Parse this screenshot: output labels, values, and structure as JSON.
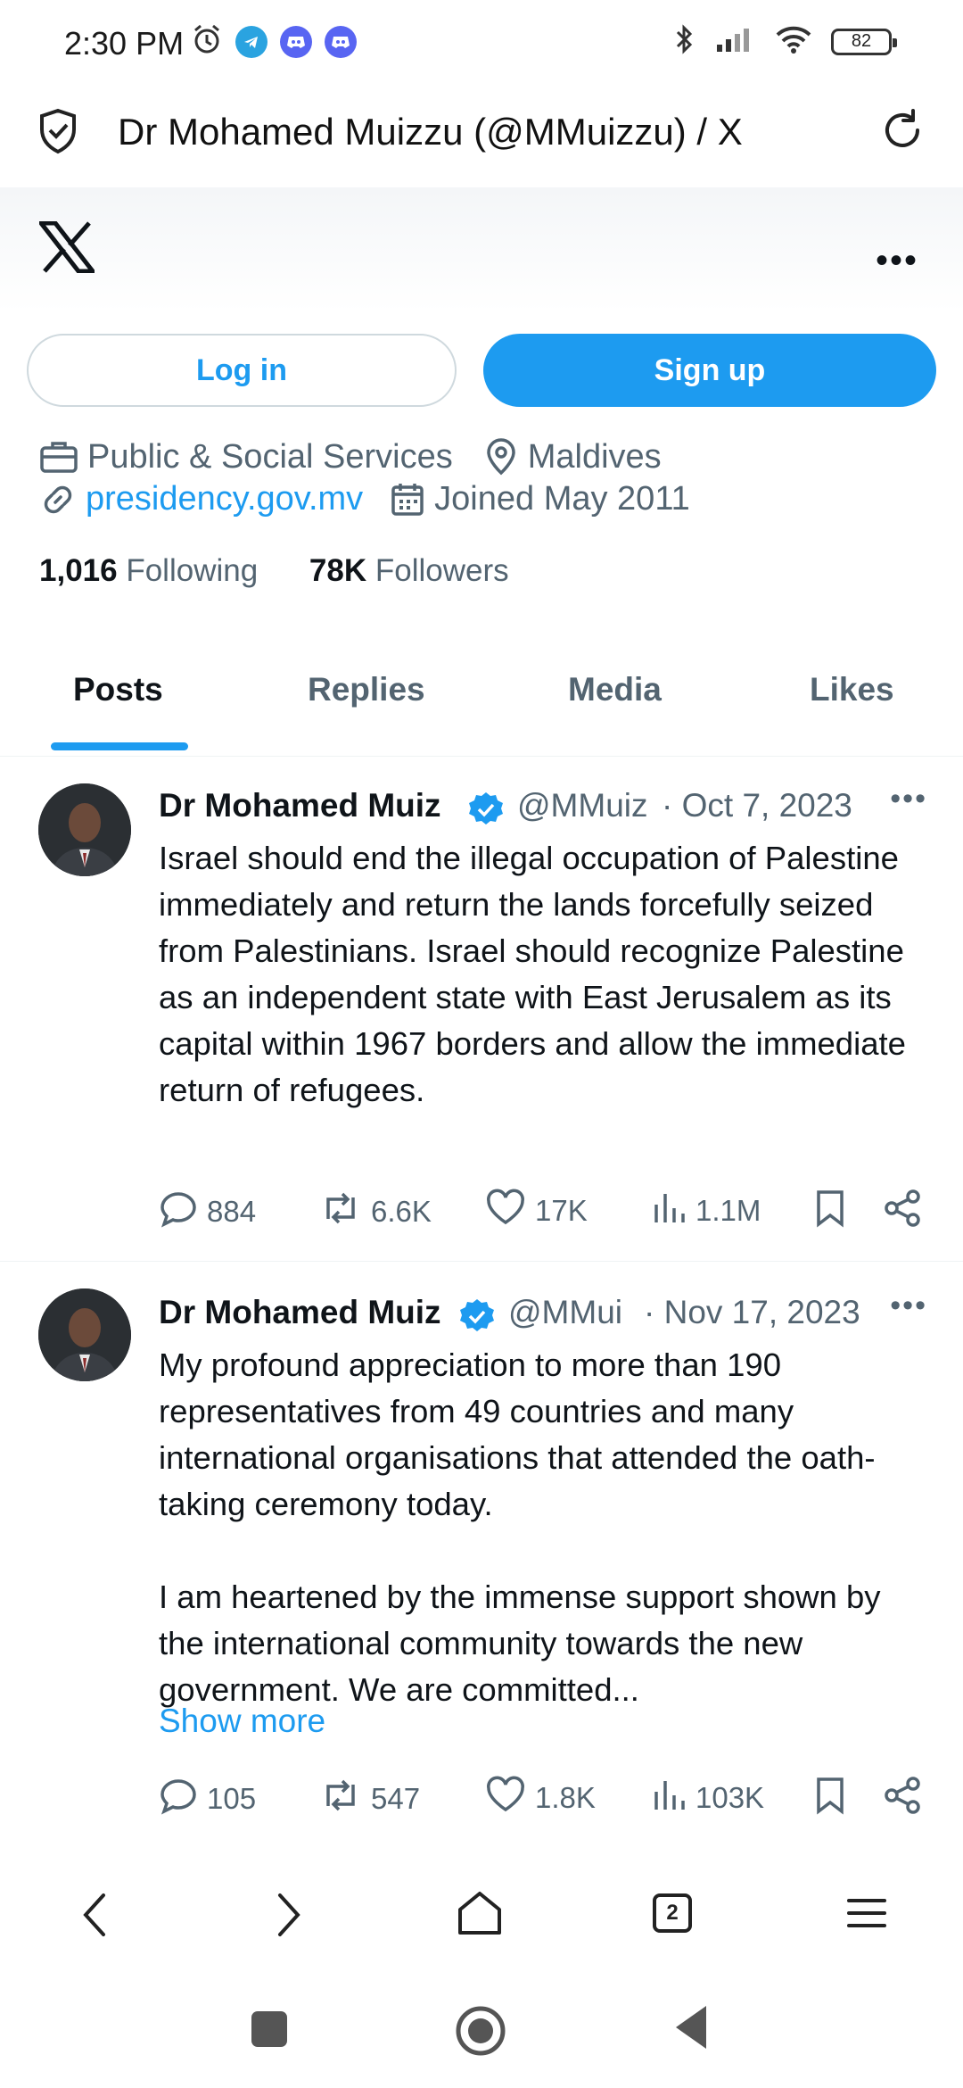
{
  "status_bar": {
    "time": "2:30 PM",
    "battery": "82"
  },
  "browser": {
    "page_title": "Dr Mohamed Muizzu (@MMuizzu) / X",
    "tab_count": "2"
  },
  "profile": {
    "login_label": "Log in",
    "signup_label": "Sign up",
    "category": "Public & Social Services",
    "location": "Maldives",
    "website": "presidency.gov.mv",
    "joined": "Joined May 2011",
    "following_count": "1,016",
    "following_label": "Following",
    "followers_count": "78K",
    "followers_label": "Followers"
  },
  "tabs": [
    {
      "label": "Posts"
    },
    {
      "label": "Replies"
    },
    {
      "label": "Media"
    },
    {
      "label": "Likes"
    }
  ],
  "posts": [
    {
      "name": "Dr Mohamed Muiz",
      "handle": "@MMuiz",
      "date": "· Oct 7, 2023",
      "text": "Israel should end the illegal occupation of Palestine immediately and return the lands forcefully seized from Palestinians. Israel should recognize Palestine as an independent state with East Jerusalem as its capital within 1967 borders and allow the immediate return of refugees.",
      "replies": "884",
      "reposts": "6.6K",
      "likes": "17K",
      "views": "1.1M"
    },
    {
      "name": "Dr Mohamed Muiz",
      "handle": "@MMui",
      "date": "· Nov 17, 2023",
      "text": "My profound appreciation to more than 190 representatives from 49 countries and many international organisations that attended the oath-taking ceremony today.\n\nI am heartened by the immense support shown by the international community towards the new government. We are committed...",
      "show_more": "Show more",
      "replies": "105",
      "reposts": "547",
      "likes": "1.8K",
      "views": "103K"
    }
  ],
  "colors": {
    "accent": "#1d9bf0",
    "text_primary": "#0f1419",
    "text_secondary": "#536471"
  }
}
